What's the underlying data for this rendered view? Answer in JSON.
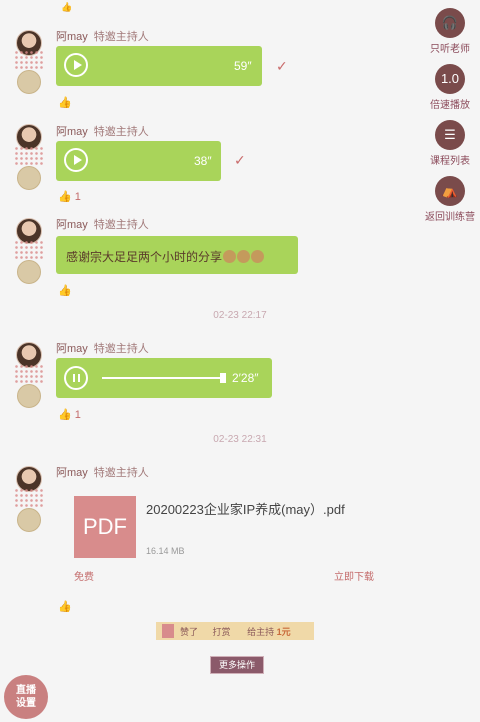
{
  "messages": [
    {
      "sender": "阿may",
      "role": "特邀主持人",
      "duration": "59″",
      "status": "✓"
    },
    {
      "sender": "阿may",
      "role": "特邀主持人",
      "duration": "38″",
      "status": "✓"
    },
    {
      "sender": "阿may",
      "role": "特邀主持人",
      "text": "感谢宗大足足两个小时的分享"
    },
    {
      "sender": "阿may",
      "role": "特邀主持人",
      "duration": "2′28″",
      "progress": 1.0
    },
    {
      "sender": "阿may",
      "role": "特邀主持人"
    }
  ],
  "timestamps": [
    "02-23 22:17",
    "02-23 22:31"
  ],
  "file": {
    "icon_text": "PDF",
    "name": "20200223企业家IP养成(may）.pdf",
    "size": "16.14 MB",
    "free_label": "免费",
    "download_label": "立即下载"
  },
  "like_counts": [
    "",
    "1",
    "",
    "1",
    ""
  ],
  "sidebar": [
    {
      "label": "只听老师",
      "icon": "headphones-icon"
    },
    {
      "label": "倍速播放",
      "icon": "speed-icon"
    },
    {
      "label": "课程列表",
      "icon": "list-icon"
    },
    {
      "label": "返回训练营",
      "icon": "camp-icon"
    }
  ],
  "gift_banner": {
    "left": "赞了",
    "middle": "打赏",
    "right": "给主持",
    "amount": "1元"
  },
  "more_button": "更多操作",
  "live_button": "直播\n设置",
  "colors": {
    "bubble": "#a9d45a",
    "accent": "#c46b6b",
    "sidebar_icon": "#7a4b4b"
  }
}
